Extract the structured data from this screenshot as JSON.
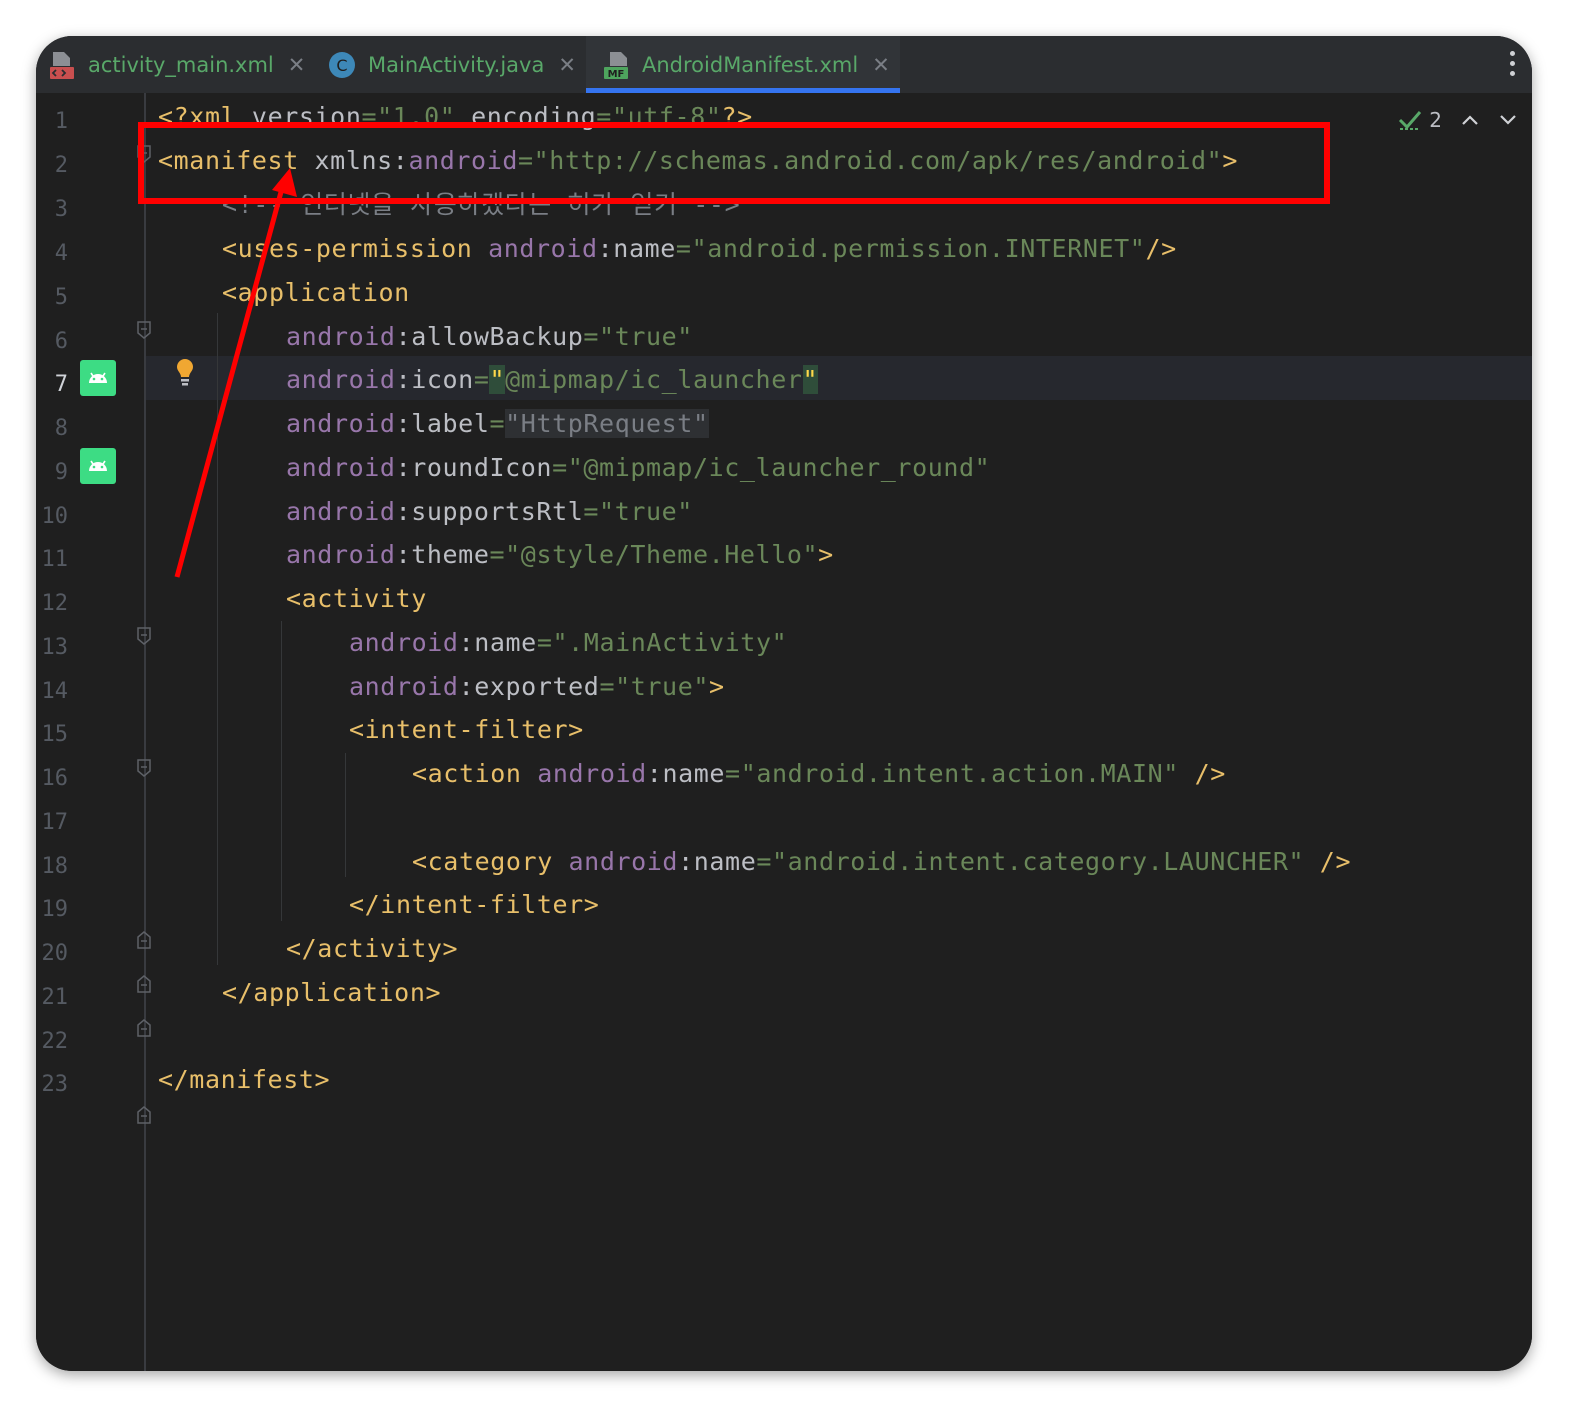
{
  "tabs": [
    {
      "label": "activity_main.xml",
      "icon": "xml-layout-icon",
      "active": false
    },
    {
      "label": "MainActivity.java",
      "icon": "java-class-icon",
      "active": false
    },
    {
      "label": "AndroidManifest.xml",
      "icon": "manifest-icon",
      "active": true
    }
  ],
  "tab_close_glyph": "✕",
  "inspections": {
    "count": "2"
  },
  "line_numbers": [
    "1",
    "2",
    "3",
    "4",
    "5",
    "6",
    "7",
    "8",
    "9",
    "10",
    "11",
    "12",
    "13",
    "14",
    "15",
    "16",
    "17",
    "18",
    "19",
    "20",
    "21",
    "22",
    "23"
  ],
  "current_line": "7",
  "colors": {
    "annotation": "#ff0000",
    "tab_underline": "#3574f0",
    "android_gutter": "#3ddc84",
    "tag": "#e8bf6a",
    "string": "#6a8759",
    "namespace": "#9876aa"
  },
  "code": {
    "l1": {
      "t1": "<?xml ",
      "a1": "version",
      "e1": "=",
      "v1": "\"1.0\"",
      "p1": " ",
      "a2": "encoding",
      "e2": "=",
      "v2": "\"utf-8\"",
      "t2": "?>"
    },
    "l2": {
      "t1": "<manifest ",
      "a1": "xmlns",
      "p1": ":",
      "n1": "android",
      "e1": "=",
      "v1": "\"http://schemas.android.com/apk/res/android\"",
      "t2": ">"
    },
    "l3": {
      "c1": "<!-- 인터넷을 사용하겠다는 허가 얻기 -->"
    },
    "l4": {
      "t1": "<uses-permission ",
      "n1": "android",
      "p1": ":",
      "a1": "name",
      "e1": "=",
      "v1": "\"android.permission.INTERNET\"",
      "t2": "/>"
    },
    "l5": {
      "t1": "<application"
    },
    "l6": {
      "n1": "android",
      "p1": ":",
      "a1": "allowBackup",
      "e1": "=",
      "v1": "\"true\""
    },
    "l7": {
      "n1": "android",
      "p1": ":",
      "a1": "icon",
      "e1": "=",
      "q1": "\"",
      "v1": "@mipmap/ic_launcher",
      "q2": "\""
    },
    "l8": {
      "n1": "android",
      "p1": ":",
      "a1": "label",
      "e1": "=",
      "v1": "\"HttpRequest\""
    },
    "l9": {
      "n1": "android",
      "p1": ":",
      "a1": "roundIcon",
      "e1": "=",
      "v1": "\"@mipmap/ic_launcher_round\""
    },
    "l10": {
      "n1": "android",
      "p1": ":",
      "a1": "supportsRtl",
      "e1": "=",
      "v1": "\"true\""
    },
    "l11": {
      "n1": "android",
      "p1": ":",
      "a1": "theme",
      "e1": "=",
      "v1": "\"@style/Theme.Hello\"",
      "t1": ">"
    },
    "l12": {
      "t1": "<activity"
    },
    "l13": {
      "n1": "android",
      "p1": ":",
      "a1": "name",
      "e1": "=",
      "v1": "\".MainActivity\""
    },
    "l14": {
      "n1": "android",
      "p1": ":",
      "a1": "exported",
      "e1": "=",
      "v1": "\"true\"",
      "t1": ">"
    },
    "l15": {
      "t1": "<intent-filter>"
    },
    "l16": {
      "t1": "<action ",
      "n1": "android",
      "p1": ":",
      "a1": "name",
      "e1": "=",
      "v1": "\"android.intent.action.MAIN\"",
      "t2": " />"
    },
    "l18": {
      "t1": "<category ",
      "n1": "android",
      "p1": ":",
      "a1": "name",
      "e1": "=",
      "v1": "\"android.intent.category.LAUNCHER\"",
      "t2": " />"
    },
    "l19": {
      "t1": "</intent-filter>"
    },
    "l20": {
      "t1": "</activity>"
    },
    "l21": {
      "t1": "</application>"
    },
    "l23": {
      "t1": "</manifest>"
    }
  }
}
